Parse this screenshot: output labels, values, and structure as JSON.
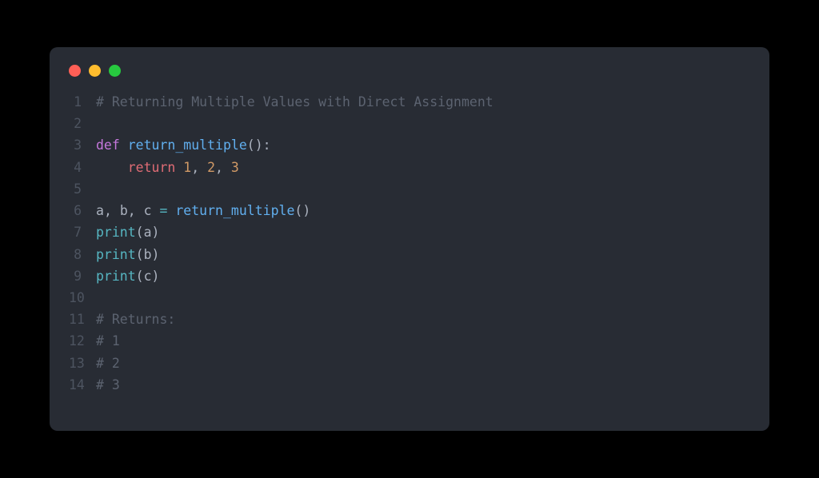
{
  "window": {
    "traffic_lights": [
      "close",
      "minimize",
      "zoom"
    ]
  },
  "code": {
    "lines": [
      {
        "n": "1",
        "tokens": [
          {
            "t": "# Returning Multiple Values with Direct Assignment",
            "c": "tok-comment"
          }
        ]
      },
      {
        "n": "2",
        "tokens": []
      },
      {
        "n": "3",
        "tokens": [
          {
            "t": "def ",
            "c": "tok-keyword"
          },
          {
            "t": "return_multiple",
            "c": "tok-def"
          },
          {
            "t": "():",
            "c": "tok-punct"
          }
        ]
      },
      {
        "n": "4",
        "tokens": [
          {
            "t": "    ",
            "c": "tok-plain"
          },
          {
            "t": "return ",
            "c": "tok-return"
          },
          {
            "t": "1",
            "c": "tok-num"
          },
          {
            "t": ", ",
            "c": "tok-punct"
          },
          {
            "t": "2",
            "c": "tok-num"
          },
          {
            "t": ", ",
            "c": "tok-punct"
          },
          {
            "t": "3",
            "c": "tok-num"
          }
        ]
      },
      {
        "n": "5",
        "tokens": []
      },
      {
        "n": "6",
        "tokens": [
          {
            "t": "a",
            "c": "tok-var"
          },
          {
            "t": ", ",
            "c": "tok-punct"
          },
          {
            "t": "b",
            "c": "tok-var"
          },
          {
            "t": ", ",
            "c": "tok-punct"
          },
          {
            "t": "c",
            "c": "tok-var"
          },
          {
            "t": " = ",
            "c": "tok-op"
          },
          {
            "t": "return_multiple",
            "c": "tok-func"
          },
          {
            "t": "()",
            "c": "tok-punct"
          }
        ]
      },
      {
        "n": "7",
        "tokens": [
          {
            "t": "print",
            "c": "tok-builtin"
          },
          {
            "t": "(",
            "c": "tok-punct"
          },
          {
            "t": "a",
            "c": "tok-var"
          },
          {
            "t": ")",
            "c": "tok-punct"
          }
        ]
      },
      {
        "n": "8",
        "tokens": [
          {
            "t": "print",
            "c": "tok-builtin"
          },
          {
            "t": "(",
            "c": "tok-punct"
          },
          {
            "t": "b",
            "c": "tok-var"
          },
          {
            "t": ")",
            "c": "tok-punct"
          }
        ]
      },
      {
        "n": "9",
        "tokens": [
          {
            "t": "print",
            "c": "tok-builtin"
          },
          {
            "t": "(",
            "c": "tok-punct"
          },
          {
            "t": "c",
            "c": "tok-var"
          },
          {
            "t": ")",
            "c": "tok-punct"
          }
        ]
      },
      {
        "n": "10",
        "tokens": []
      },
      {
        "n": "11",
        "tokens": [
          {
            "t": "# Returns:",
            "c": "tok-comment"
          }
        ]
      },
      {
        "n": "12",
        "tokens": [
          {
            "t": "# 1",
            "c": "tok-comment"
          }
        ]
      },
      {
        "n": "13",
        "tokens": [
          {
            "t": "# 2",
            "c": "tok-comment"
          }
        ]
      },
      {
        "n": "14",
        "tokens": [
          {
            "t": "# 3",
            "c": "tok-comment"
          }
        ]
      }
    ]
  }
}
